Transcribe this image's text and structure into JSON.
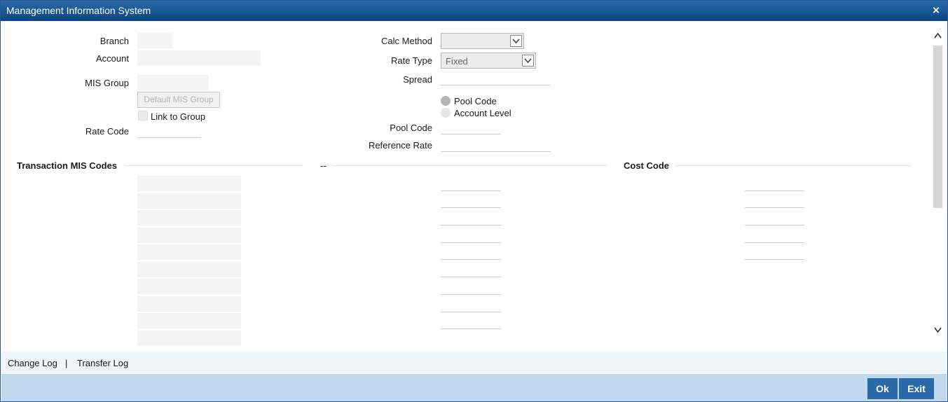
{
  "window": {
    "title": "Management Information System",
    "close_symbol": "×"
  },
  "form": {
    "branch_label": "Branch",
    "account_label": "Account",
    "mis_group_label": "MIS Group",
    "default_mis_group_button": "Default MIS Group",
    "link_to_group_label": "Link to Group",
    "rate_code_label": "Rate Code",
    "calc_method_label": "Calc Method",
    "calc_method_value": "",
    "rate_type_label": "Rate Type",
    "rate_type_value": "Fixed",
    "spread_label": "Spread",
    "pool_code_radio_label": "Pool Code",
    "account_level_radio_label": "Account Level",
    "pool_code_label": "Pool Code",
    "reference_rate_label": "Reference Rate"
  },
  "sections": {
    "transaction_mis_codes": "Transaction MIS Codes",
    "middle": "--",
    "cost_code": "Cost Code"
  },
  "logbar": {
    "change_log": "Change Log",
    "separator": "|",
    "transfer_log": "Transfer Log"
  },
  "footer": {
    "ok": "Ok",
    "exit": "Exit"
  },
  "icons": {
    "close": "close-icon",
    "dropdown": "chevron-down-icon",
    "scroll_up": "chevron-up-icon",
    "scroll_down": "chevron-down-icon"
  },
  "colors": {
    "titlebar": "#0f4e8a",
    "footer": "#c1d7eb",
    "button": "#2a6aa8"
  }
}
